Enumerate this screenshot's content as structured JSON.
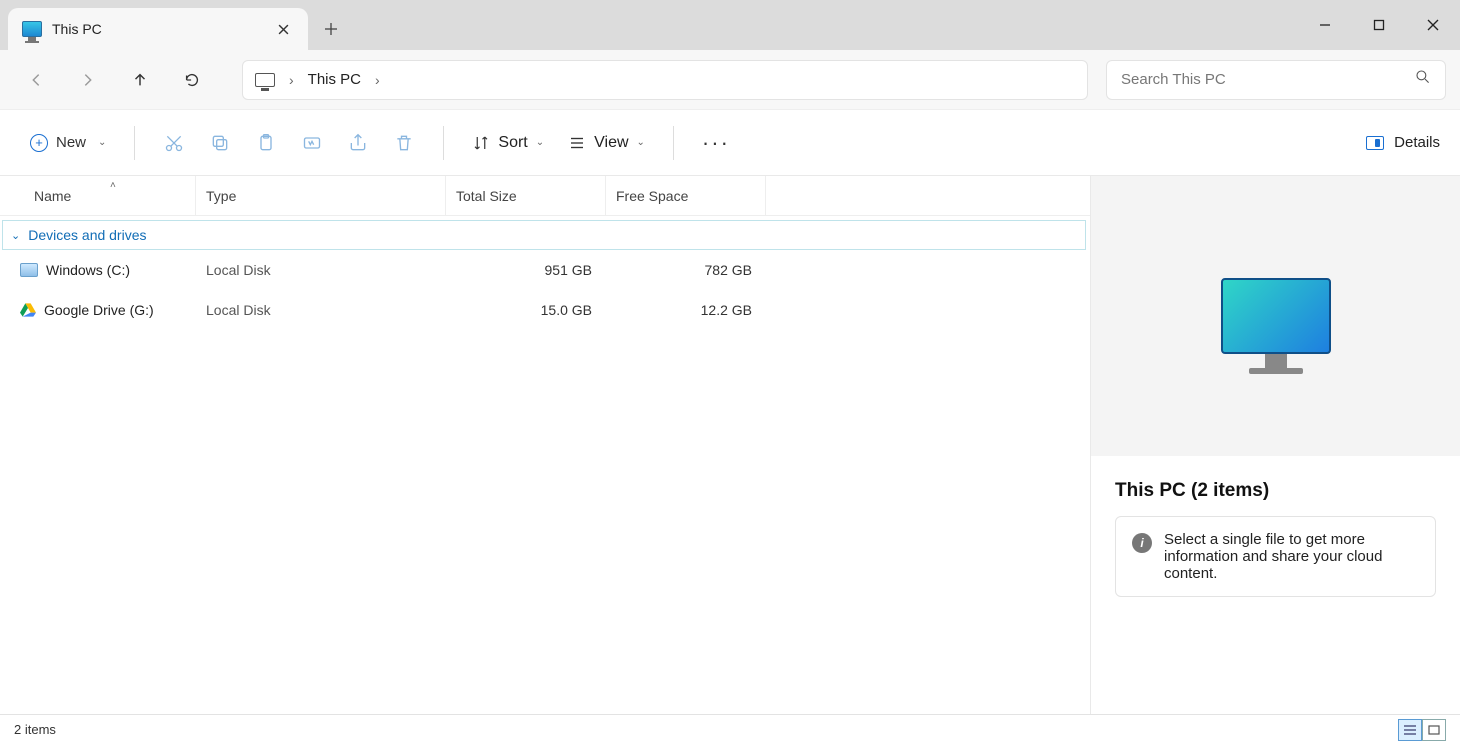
{
  "tab": {
    "title": "This PC"
  },
  "address": {
    "crumb": "This PC"
  },
  "search": {
    "placeholder": "Search This PC"
  },
  "toolbar": {
    "new_label": "New",
    "sort_label": "Sort",
    "view_label": "View",
    "details_label": "Details"
  },
  "columns": {
    "name": "Name",
    "type": "Type",
    "total": "Total Size",
    "free": "Free Space"
  },
  "group": {
    "label": "Devices and drives"
  },
  "drives": [
    {
      "name": "Windows (C:)",
      "type": "Local Disk",
      "total": "951 GB",
      "free": "782 GB",
      "icon": "disk"
    },
    {
      "name": "Google Drive (G:)",
      "type": "Local Disk",
      "total": "15.0 GB",
      "free": "12.2 GB",
      "icon": "gdrive"
    }
  ],
  "details": {
    "title": "This PC (2 items)",
    "hint": "Select a single file to get more information and share your cloud content."
  },
  "status": {
    "text": "2 items"
  }
}
